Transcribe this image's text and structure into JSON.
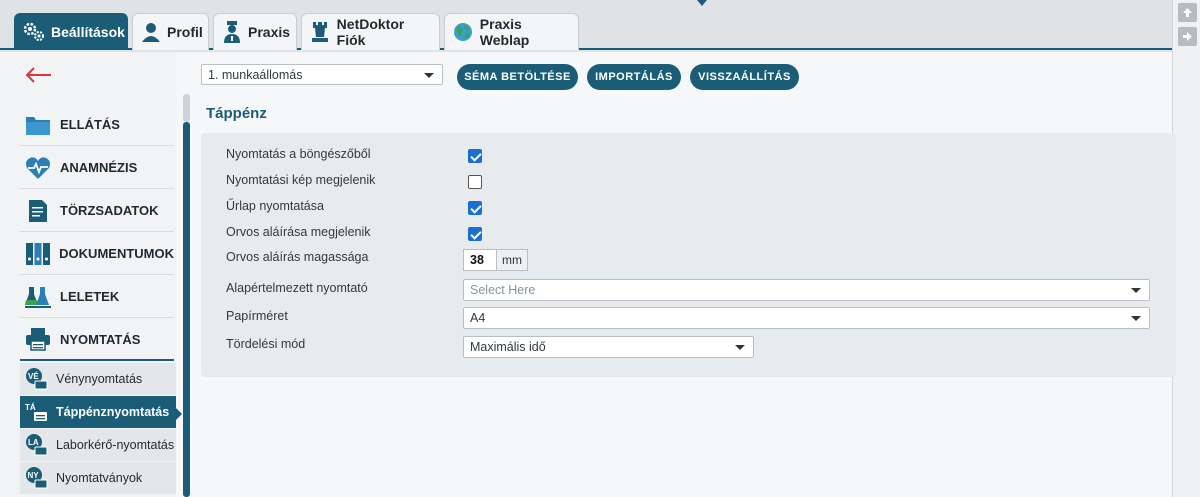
{
  "tabs": [
    {
      "label": "Beállítások",
      "icon": "gears-icon",
      "active": true
    },
    {
      "label": "Profil",
      "icon": "user-icon"
    },
    {
      "label": "Praxis",
      "icon": "doctor-icon"
    },
    {
      "label": "NetDoktor Fiók",
      "icon": "chess-rook-icon"
    },
    {
      "label": "Praxis Weblap",
      "icon": "globe-icon"
    }
  ],
  "sidebar": {
    "items": [
      {
        "label": "ELLÁTÁS",
        "icon": "folder-icon"
      },
      {
        "label": "ANAMNÉZIS",
        "icon": "heartbeat-icon"
      },
      {
        "label": "TÖRZSADATOK",
        "icon": "document-icon"
      },
      {
        "label": "DOKUMENTUMOK",
        "icon": "binders-icon"
      },
      {
        "label": "LELETEK",
        "icon": "flasks-icon"
      },
      {
        "label": "NYOMTATÁS",
        "icon": "printer-icon"
      }
    ],
    "subitems": [
      {
        "label": "Vénynyomtatás",
        "badge": "VÉ"
      },
      {
        "label": "Táppénznyomtatás",
        "badge": "TÁ",
        "active": true
      },
      {
        "label": "Laborkérő-nyomtatás",
        "badge": "LA"
      },
      {
        "label": "Nyomtatványok",
        "badge": "NY"
      }
    ]
  },
  "toolbar": {
    "workstation": "1. munkaállomás",
    "load_schema": "SÉMA BETÖLTÉSE",
    "import": "IMPORTÁLÁS",
    "restore": "VISSZAÁLLÍTÁS"
  },
  "section": {
    "title": "Táppénz",
    "rows": [
      {
        "label": "Nyomtatás a böngészőből",
        "checked": true
      },
      {
        "label": "Nyomtatási kép megjelenik",
        "checked": false
      },
      {
        "label": "Űrlap nyomtatása",
        "checked": true
      },
      {
        "label": "Orvos aláírása megjelenik",
        "checked": true
      },
      {
        "label": "Orvos aláírás magassága",
        "value": "38",
        "unit": "mm"
      },
      {
        "label": "Alapértelmezett nyomtató",
        "placeholder": "Select Here"
      },
      {
        "label": "Papírméret",
        "value": "A4"
      },
      {
        "label": "Tördelési mód",
        "value": "Maximális idő"
      }
    ]
  },
  "colors": {
    "primary": "#1b5d77",
    "checkbox": "#1a6fd0"
  }
}
